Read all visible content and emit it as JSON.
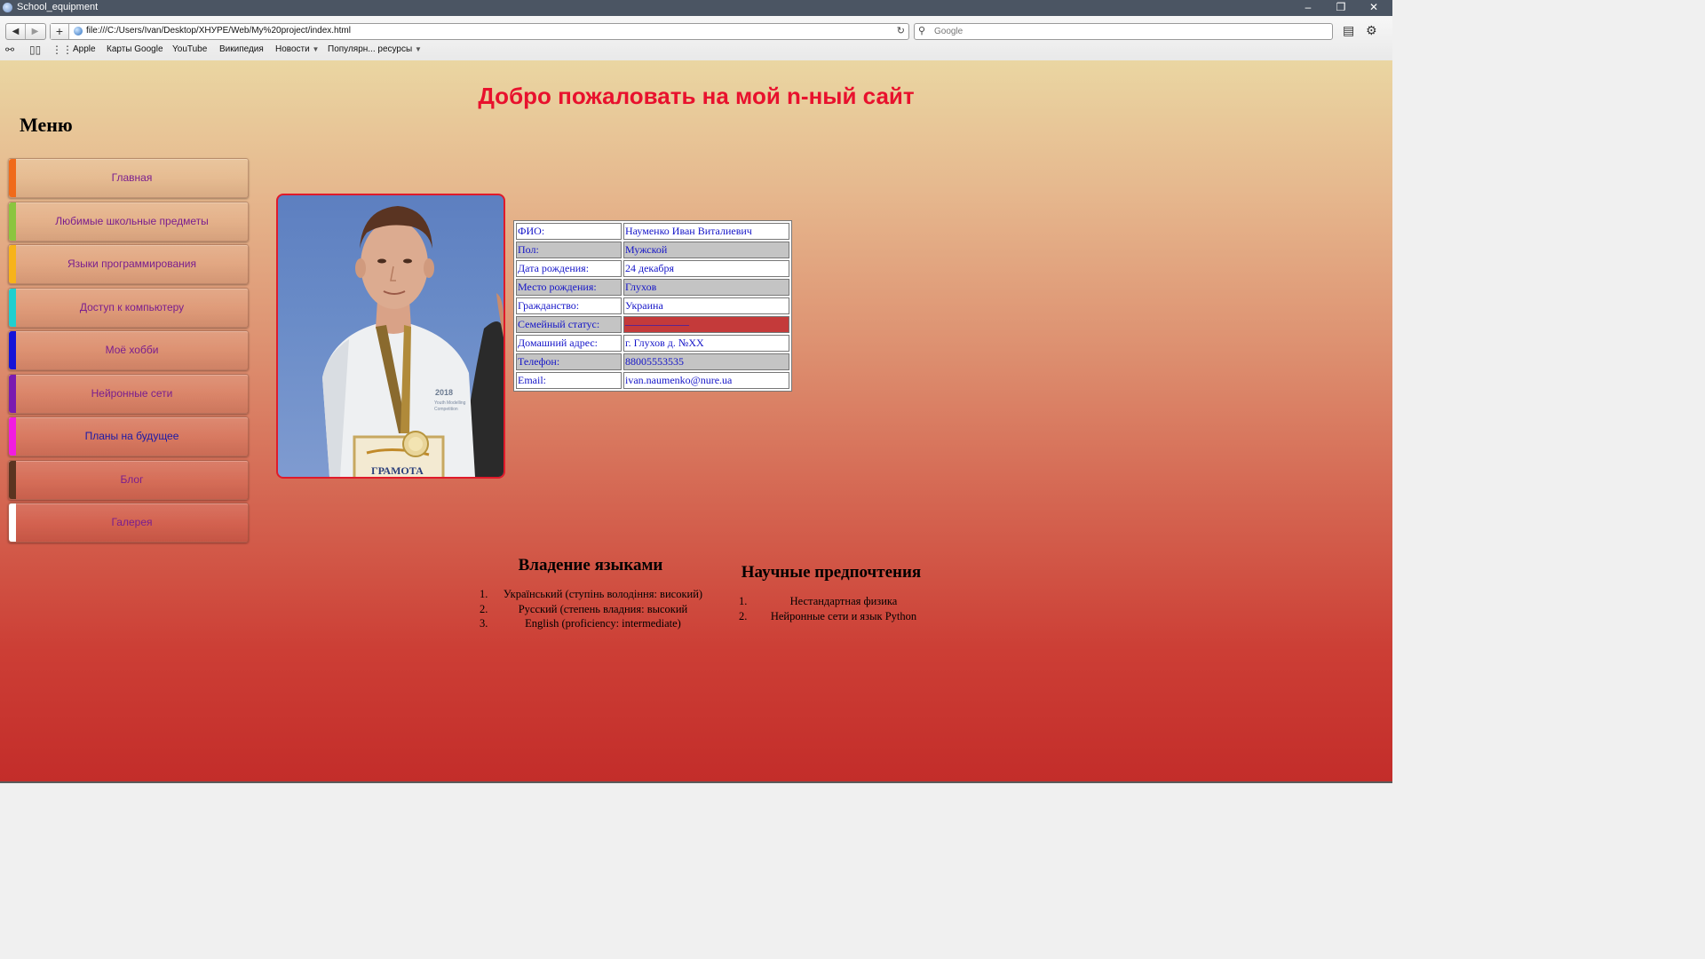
{
  "window": {
    "title": "School_equipment",
    "controls": [
      "–",
      "❐",
      "✕"
    ]
  },
  "toolbar": {
    "url": "file:///C:/Users/Ivan/Desktop/ХНУРЕ/Web/My%20project/index.html",
    "search_placeholder": "Google"
  },
  "bookmarks": [
    {
      "label": "Apple"
    },
    {
      "label": "Карты Google"
    },
    {
      "label": "YouTube"
    },
    {
      "label": "Википедия"
    },
    {
      "label": "Новости"
    },
    {
      "label": "Популярн... ресурсы"
    }
  ],
  "page": {
    "title": "Добро пожаловать на мой n-ный сайт",
    "menu_title": "Меню",
    "menu": [
      {
        "label": "Главная",
        "color": "#f06a1a"
      },
      {
        "label": "Любимые школьные предметы",
        "color": "#8bc53f"
      },
      {
        "label": "Языки программирования",
        "color": "#f7b31a"
      },
      {
        "label": "Доступ к компьютеру",
        "color": "#1fcfcf"
      },
      {
        "label": "Моё хобби",
        "color": "#1414d8"
      },
      {
        "label": "Нейронные сети",
        "color": "#7a1bb0"
      },
      {
        "label": "Планы на будущее",
        "color": "#f21de0"
      },
      {
        "label": "Блог",
        "color": "#5a3420"
      },
      {
        "label": "Галерея",
        "color": "#ffffff"
      }
    ],
    "photo_text": {
      "shirt": "2018",
      "shirt_line2": "Youth Modelling",
      "shirt_line3": "Competition",
      "certificate": "ГРАМОТА"
    },
    "info": [
      {
        "key": "ФИО:",
        "value": "Науменко Иван Виталиевич"
      },
      {
        "key": "Пол:",
        "value": "Мужской"
      },
      {
        "key": "Дата рождения:",
        "value": "24 декабря"
      },
      {
        "key": "Место рождения:",
        "value": "Глухов"
      },
      {
        "key": "Гражданство:",
        "value": "Украина"
      },
      {
        "key": "Семейный статус:",
        "value": "——————"
      },
      {
        "key": "Домашний адрес:",
        "value": "г. Глухов д. №ХХ"
      },
      {
        "key": "Телефон:",
        "value": "88005553535"
      },
      {
        "key": "Email:",
        "value": "ivan.naumenko@nure.ua"
      }
    ],
    "languages": {
      "title": "Владение языками",
      "items": [
        "Український (ступінь володіння: високий)",
        "Русский (степень владния: высокий",
        "English (proficiency: intermediate)"
      ]
    },
    "science": {
      "title": "Научные предпочтения",
      "items": [
        "Нестандартная физика",
        "Нейронные сети и язык Python"
      ]
    }
  },
  "colors": {
    "title": "#e8112d",
    "link": "#7a1e8e",
    "table_text": "#1414c8",
    "family_status_bg": "#c43a3a"
  }
}
